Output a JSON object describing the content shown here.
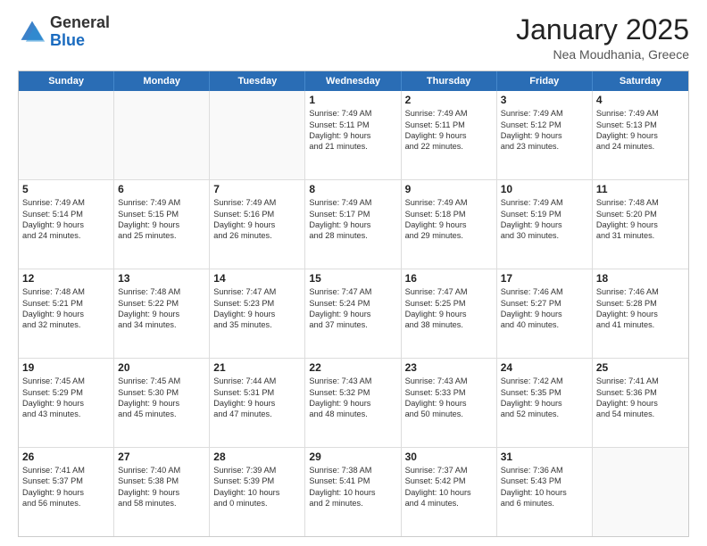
{
  "logo": {
    "general": "General",
    "blue": "Blue"
  },
  "header": {
    "month_year": "January 2025",
    "location": "Nea Moudhania, Greece"
  },
  "weekdays": [
    "Sunday",
    "Monday",
    "Tuesday",
    "Wednesday",
    "Thursday",
    "Friday",
    "Saturday"
  ],
  "weeks": [
    [
      {
        "day": "",
        "lines": []
      },
      {
        "day": "",
        "lines": []
      },
      {
        "day": "",
        "lines": []
      },
      {
        "day": "1",
        "lines": [
          "Sunrise: 7:49 AM",
          "Sunset: 5:11 PM",
          "Daylight: 9 hours",
          "and 21 minutes."
        ]
      },
      {
        "day": "2",
        "lines": [
          "Sunrise: 7:49 AM",
          "Sunset: 5:11 PM",
          "Daylight: 9 hours",
          "and 22 minutes."
        ]
      },
      {
        "day": "3",
        "lines": [
          "Sunrise: 7:49 AM",
          "Sunset: 5:12 PM",
          "Daylight: 9 hours",
          "and 23 minutes."
        ]
      },
      {
        "day": "4",
        "lines": [
          "Sunrise: 7:49 AM",
          "Sunset: 5:13 PM",
          "Daylight: 9 hours",
          "and 24 minutes."
        ]
      }
    ],
    [
      {
        "day": "5",
        "lines": [
          "Sunrise: 7:49 AM",
          "Sunset: 5:14 PM",
          "Daylight: 9 hours",
          "and 24 minutes."
        ]
      },
      {
        "day": "6",
        "lines": [
          "Sunrise: 7:49 AM",
          "Sunset: 5:15 PM",
          "Daylight: 9 hours",
          "and 25 minutes."
        ]
      },
      {
        "day": "7",
        "lines": [
          "Sunrise: 7:49 AM",
          "Sunset: 5:16 PM",
          "Daylight: 9 hours",
          "and 26 minutes."
        ]
      },
      {
        "day": "8",
        "lines": [
          "Sunrise: 7:49 AM",
          "Sunset: 5:17 PM",
          "Daylight: 9 hours",
          "and 28 minutes."
        ]
      },
      {
        "day": "9",
        "lines": [
          "Sunrise: 7:49 AM",
          "Sunset: 5:18 PM",
          "Daylight: 9 hours",
          "and 29 minutes."
        ]
      },
      {
        "day": "10",
        "lines": [
          "Sunrise: 7:49 AM",
          "Sunset: 5:19 PM",
          "Daylight: 9 hours",
          "and 30 minutes."
        ]
      },
      {
        "day": "11",
        "lines": [
          "Sunrise: 7:48 AM",
          "Sunset: 5:20 PM",
          "Daylight: 9 hours",
          "and 31 minutes."
        ]
      }
    ],
    [
      {
        "day": "12",
        "lines": [
          "Sunrise: 7:48 AM",
          "Sunset: 5:21 PM",
          "Daylight: 9 hours",
          "and 32 minutes."
        ]
      },
      {
        "day": "13",
        "lines": [
          "Sunrise: 7:48 AM",
          "Sunset: 5:22 PM",
          "Daylight: 9 hours",
          "and 34 minutes."
        ]
      },
      {
        "day": "14",
        "lines": [
          "Sunrise: 7:47 AM",
          "Sunset: 5:23 PM",
          "Daylight: 9 hours",
          "and 35 minutes."
        ]
      },
      {
        "day": "15",
        "lines": [
          "Sunrise: 7:47 AM",
          "Sunset: 5:24 PM",
          "Daylight: 9 hours",
          "and 37 minutes."
        ]
      },
      {
        "day": "16",
        "lines": [
          "Sunrise: 7:47 AM",
          "Sunset: 5:25 PM",
          "Daylight: 9 hours",
          "and 38 minutes."
        ]
      },
      {
        "day": "17",
        "lines": [
          "Sunrise: 7:46 AM",
          "Sunset: 5:27 PM",
          "Daylight: 9 hours",
          "and 40 minutes."
        ]
      },
      {
        "day": "18",
        "lines": [
          "Sunrise: 7:46 AM",
          "Sunset: 5:28 PM",
          "Daylight: 9 hours",
          "and 41 minutes."
        ]
      }
    ],
    [
      {
        "day": "19",
        "lines": [
          "Sunrise: 7:45 AM",
          "Sunset: 5:29 PM",
          "Daylight: 9 hours",
          "and 43 minutes."
        ]
      },
      {
        "day": "20",
        "lines": [
          "Sunrise: 7:45 AM",
          "Sunset: 5:30 PM",
          "Daylight: 9 hours",
          "and 45 minutes."
        ]
      },
      {
        "day": "21",
        "lines": [
          "Sunrise: 7:44 AM",
          "Sunset: 5:31 PM",
          "Daylight: 9 hours",
          "and 47 minutes."
        ]
      },
      {
        "day": "22",
        "lines": [
          "Sunrise: 7:43 AM",
          "Sunset: 5:32 PM",
          "Daylight: 9 hours",
          "and 48 minutes."
        ]
      },
      {
        "day": "23",
        "lines": [
          "Sunrise: 7:43 AM",
          "Sunset: 5:33 PM",
          "Daylight: 9 hours",
          "and 50 minutes."
        ]
      },
      {
        "day": "24",
        "lines": [
          "Sunrise: 7:42 AM",
          "Sunset: 5:35 PM",
          "Daylight: 9 hours",
          "and 52 minutes."
        ]
      },
      {
        "day": "25",
        "lines": [
          "Sunrise: 7:41 AM",
          "Sunset: 5:36 PM",
          "Daylight: 9 hours",
          "and 54 minutes."
        ]
      }
    ],
    [
      {
        "day": "26",
        "lines": [
          "Sunrise: 7:41 AM",
          "Sunset: 5:37 PM",
          "Daylight: 9 hours",
          "and 56 minutes."
        ]
      },
      {
        "day": "27",
        "lines": [
          "Sunrise: 7:40 AM",
          "Sunset: 5:38 PM",
          "Daylight: 9 hours",
          "and 58 minutes."
        ]
      },
      {
        "day": "28",
        "lines": [
          "Sunrise: 7:39 AM",
          "Sunset: 5:39 PM",
          "Daylight: 10 hours",
          "and 0 minutes."
        ]
      },
      {
        "day": "29",
        "lines": [
          "Sunrise: 7:38 AM",
          "Sunset: 5:41 PM",
          "Daylight: 10 hours",
          "and 2 minutes."
        ]
      },
      {
        "day": "30",
        "lines": [
          "Sunrise: 7:37 AM",
          "Sunset: 5:42 PM",
          "Daylight: 10 hours",
          "and 4 minutes."
        ]
      },
      {
        "day": "31",
        "lines": [
          "Sunrise: 7:36 AM",
          "Sunset: 5:43 PM",
          "Daylight: 10 hours",
          "and 6 minutes."
        ]
      },
      {
        "day": "",
        "lines": []
      }
    ]
  ]
}
